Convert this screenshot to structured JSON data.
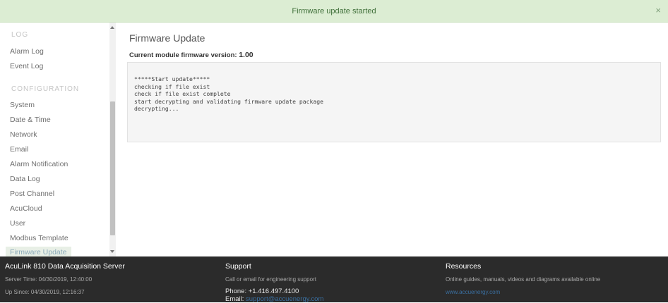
{
  "notification": {
    "message": "Firmware update started",
    "close_glyph": "×",
    "color": "#dcedd3"
  },
  "sidebar": {
    "log_heading": "LOG",
    "log_items": [
      {
        "label": "Alarm Log"
      },
      {
        "label": "Event Log"
      }
    ],
    "config_heading": "CONFIGURATION",
    "config_items": [
      {
        "label": "System"
      },
      {
        "label": "Date & Time"
      },
      {
        "label": "Network"
      },
      {
        "label": "Email"
      },
      {
        "label": "Alarm Notification"
      },
      {
        "label": "Data Log"
      },
      {
        "label": "Post Channel"
      },
      {
        "label": "AcuCloud"
      },
      {
        "label": "User"
      },
      {
        "label": "Modbus Template"
      },
      {
        "label": "Firmware Update",
        "active": true
      }
    ]
  },
  "main": {
    "title": "Firmware Update",
    "version_label": "Current module firmware version:",
    "version_value": "1.00",
    "log_lines": [
      "*****Start update*****",
      "checking if file exist",
      "check if file exist complete",
      "start decrypting and validating firmware update package",
      "decrypting..."
    ]
  },
  "footer": {
    "product": {
      "title": "AcuLink 810 Data Acquisition Server",
      "server_time": "Server Time: 04/30/2019, 12:40:00",
      "up_since": "Up Since: 04/30/2019, 12:16:37"
    },
    "support": {
      "title": "Support",
      "desc": "Call or email for engineering support",
      "phone": "Phone: +1.416.497.4100",
      "email_label": "Email:",
      "email": "support@accuenergy.com"
    },
    "resources": {
      "title": "Resources",
      "desc": "Online guides, manuals, videos and diagrams available online",
      "link": "www.accuenergy.com"
    }
  }
}
